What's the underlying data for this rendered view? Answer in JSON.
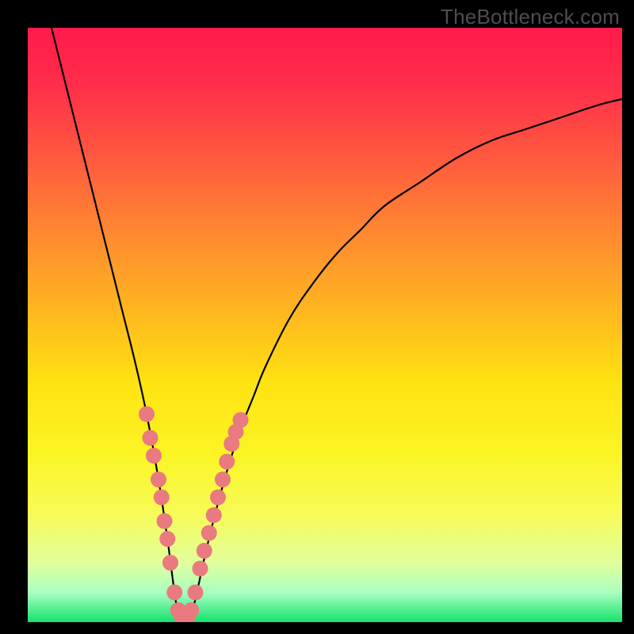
{
  "watermark": {
    "text": "TheBottleneck.com"
  },
  "chart_data": {
    "type": "line",
    "title": "",
    "xlabel": "",
    "ylabel": "",
    "xlim": [
      0,
      100
    ],
    "ylim": [
      0,
      100
    ],
    "series": [
      {
        "name": "bottleneck-curve",
        "x": [
          4,
          6,
          8,
          10,
          12,
          14,
          16,
          18,
          20,
          22,
          23.5,
          25,
          26,
          27,
          28,
          30,
          32,
          34,
          36,
          38,
          40,
          44,
          48,
          52,
          56,
          60,
          66,
          72,
          78,
          84,
          90,
          96,
          100
        ],
        "y": [
          100,
          92,
          84,
          76,
          68,
          60,
          52,
          44,
          35,
          24,
          14,
          3,
          0,
          0,
          3,
          12,
          20,
          27,
          33,
          38,
          43,
          51,
          57,
          62,
          66,
          70,
          74,
          78,
          81,
          83,
          85,
          87,
          88
        ]
      }
    ],
    "markers": {
      "name": "highlighted-points",
      "color": "#e97a7f",
      "points": [
        {
          "x": 20.0,
          "y": 35
        },
        {
          "x": 20.6,
          "y": 31
        },
        {
          "x": 21.2,
          "y": 28
        },
        {
          "x": 22.0,
          "y": 24
        },
        {
          "x": 22.5,
          "y": 21
        },
        {
          "x": 23.0,
          "y": 17
        },
        {
          "x": 23.5,
          "y": 14
        },
        {
          "x": 24.0,
          "y": 10
        },
        {
          "x": 24.7,
          "y": 5
        },
        {
          "x": 25.3,
          "y": 2
        },
        {
          "x": 26.0,
          "y": 0.5
        },
        {
          "x": 26.8,
          "y": 0.5
        },
        {
          "x": 27.5,
          "y": 2
        },
        {
          "x": 28.2,
          "y": 5
        },
        {
          "x": 29.0,
          "y": 9
        },
        {
          "x": 29.7,
          "y": 12
        },
        {
          "x": 30.5,
          "y": 15
        },
        {
          "x": 31.3,
          "y": 18
        },
        {
          "x": 32.0,
          "y": 21
        },
        {
          "x": 32.8,
          "y": 24
        },
        {
          "x": 33.5,
          "y": 27
        },
        {
          "x": 34.3,
          "y": 30
        },
        {
          "x": 35.0,
          "y": 32
        },
        {
          "x": 35.8,
          "y": 34
        }
      ]
    },
    "gradient_stops": [
      {
        "offset": 0.0,
        "color": "#ff1a4b"
      },
      {
        "offset": 0.1,
        "color": "#ff2f4a"
      },
      {
        "offset": 0.22,
        "color": "#ff5a3f"
      },
      {
        "offset": 0.35,
        "color": "#ff8a30"
      },
      {
        "offset": 0.48,
        "color": "#ffb81f"
      },
      {
        "offset": 0.6,
        "color": "#ffe312"
      },
      {
        "offset": 0.72,
        "color": "#fbf526"
      },
      {
        "offset": 0.82,
        "color": "#f7fb59"
      },
      {
        "offset": 0.9,
        "color": "#e1ff9d"
      },
      {
        "offset": 0.95,
        "color": "#aaffc0"
      },
      {
        "offset": 1.0,
        "color": "#15e26e"
      }
    ]
  }
}
